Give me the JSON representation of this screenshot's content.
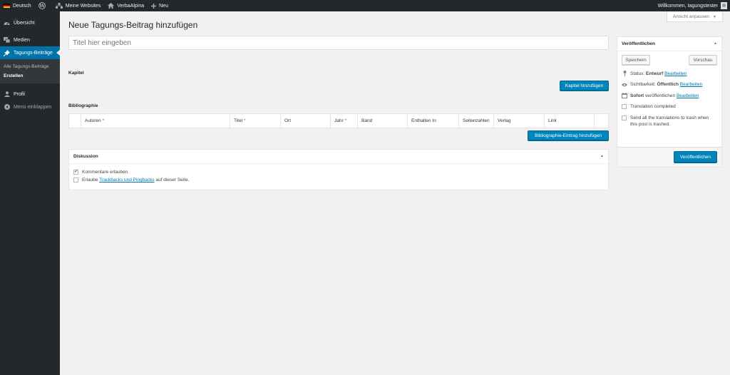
{
  "adminbar": {
    "language": "Deutsch",
    "my_sites": "Meine Websites",
    "site_name": "VerbaAlpina",
    "new": "Neu",
    "greeting": "Willkommen, tagungstester"
  },
  "sidebar": {
    "items": [
      {
        "label": "Übersicht",
        "icon": "dashboard-icon"
      },
      {
        "label": "Medien",
        "icon": "media-icon"
      },
      {
        "label": "Tagungs-Beiträge",
        "icon": "pin-icon"
      },
      {
        "label": "Profil",
        "icon": "user-icon"
      },
      {
        "label": "Menü einklappen",
        "icon": "collapse-icon"
      }
    ],
    "submenu": [
      "Alle Tagungs-Beiträge",
      "Erstellen"
    ]
  },
  "main": {
    "screen_options": "Ansicht anpassen",
    "page_title": "Neue Tagungs-Beitrag hinzufügen",
    "title_placeholder": "Titel hier eingeben",
    "kapitel_label": "Kapitel",
    "kapitel_button": "Kapitel hinzufügen",
    "bib_label": "Bibliographie",
    "bib_columns": [
      "Autoren",
      "Titel",
      "Ort",
      "Jahr",
      "Band",
      "Enthalten In",
      "Seitenzahlen",
      "Verlag",
      "Link"
    ],
    "bib_button": "Bibliographie-Eintrag hinzufügen"
  },
  "discussion": {
    "title": "Diskussion",
    "allow_comments": "Kommentare erlauben.",
    "trackbacks_prefix": "Erlaube",
    "trackbacks_link": "Trackbacks und Pingbacks",
    "trackbacks_suffix": "auf dieser Seite."
  },
  "publish": {
    "title": "Veröffentlichen",
    "save": "Speichern",
    "preview": "Vorschau",
    "status_label": "Status:",
    "status_value": "Entwurf",
    "visibility_label": "Sichtbarkeit:",
    "visibility_value": "Öffentlich",
    "schedule_value": "Sofort",
    "schedule_label": "veröffentlichen",
    "edit": "Bearbeiten",
    "translation_completed": "Translation completed",
    "trash_translations": "Send all the translations to trash when this post is trashed.",
    "publish_button": "Veröffentlichen"
  },
  "colors": {
    "adminbar_bg": "#23282d",
    "accent": "#0073aa",
    "button_primary": "#0085ba"
  }
}
